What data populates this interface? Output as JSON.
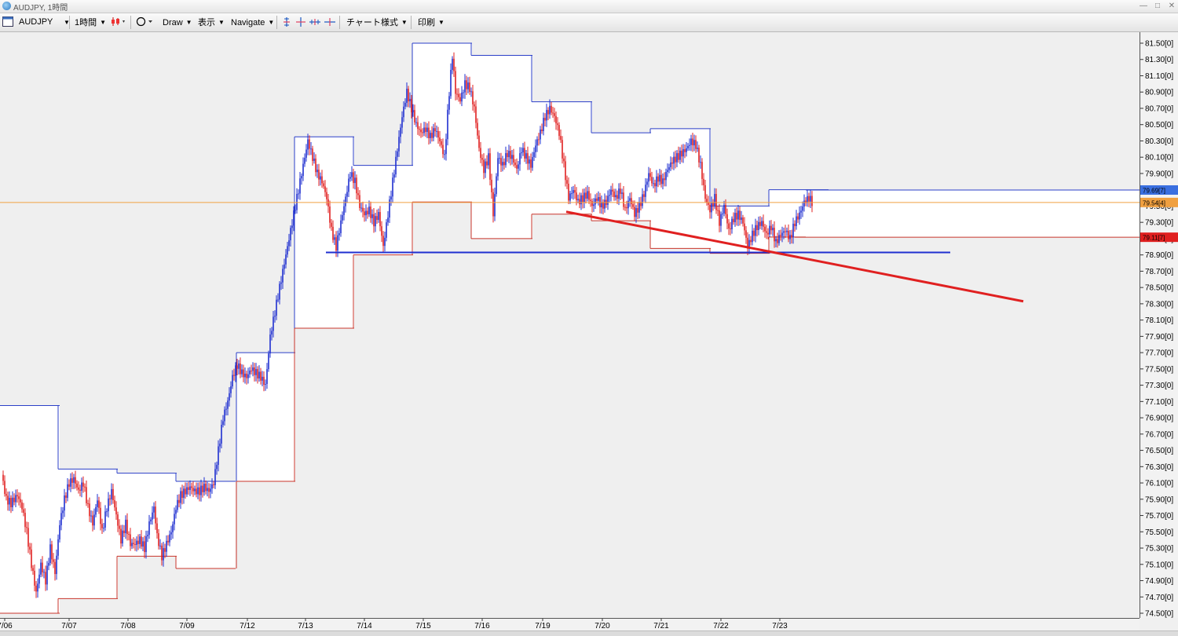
{
  "window": {
    "title": "AUDJPY, 1時間"
  },
  "toolbar": {
    "symbol": "AUDJPY",
    "timeframe": "1時間",
    "draw": "Draw",
    "display": "表示",
    "navigate": "Navigate",
    "chart_style": "チャート様式",
    "print": "印刷"
  },
  "chart_data": {
    "type": "candlestick",
    "symbol": "AUDJPY",
    "timeframe": "1時間",
    "ylim": [
      74.5,
      81.6
    ],
    "y_ticks": [
      "81.50[0]",
      "81.30[0]",
      "81.10[0]",
      "80.90[0]",
      "80.70[0]",
      "80.50[0]",
      "80.30[0]",
      "80.10[0]",
      "79.90[0]",
      "79.70[0]",
      "79.50[0]",
      "79.30[0]",
      "79.10[0]",
      "78.90[0]",
      "78.70[0]",
      "78.50[0]",
      "78.30[0]",
      "78.10[0]",
      "77.90[0]",
      "77.70[0]",
      "77.50[0]",
      "77.30[0]",
      "77.10[0]",
      "76.90[0]",
      "76.70[0]",
      "76.50[0]",
      "76.30[0]",
      "76.10[0]",
      "75.90[0]",
      "75.70[0]",
      "75.50[0]",
      "75.30[0]",
      "75.10[0]",
      "74.90[0]",
      "74.70[0]",
      "74.50[0]"
    ],
    "x_ticks": [
      "7/06",
      "7/07",
      "7/08",
      "7/09",
      "7/12",
      "7/13",
      "7/14",
      "7/15",
      "7/16",
      "7/19",
      "7/20",
      "7/21",
      "7/22",
      "7/23"
    ],
    "price_markers": [
      {
        "label": "79.69[7]",
        "value": 79.697,
        "color": "#3a6fe0"
      },
      {
        "label": "79.54[4]",
        "value": 79.544,
        "color": "#f0a040"
      },
      {
        "label": "79.11[7]",
        "value": 79.117,
        "color": "#e02020"
      }
    ],
    "current_price_line": 79.544,
    "support_line": {
      "value": 78.93,
      "color": "#1f2fd0"
    },
    "trend_line": {
      "from": [
        "7/19",
        79.43
      ],
      "to": [
        "7/23",
        78.92
      ],
      "color": "#e02020"
    },
    "daily_range_boxes": [
      {
        "label": "7/06",
        "high": 77.05,
        "low": 74.5
      },
      {
        "label": "7/07",
        "high": 76.27,
        "low": 74.68
      },
      {
        "label": "7/08",
        "high": 76.22,
        "low": 75.2
      },
      {
        "label": "7/09",
        "high": 76.12,
        "low": 75.05
      },
      {
        "label": "7/12",
        "high": 77.7,
        "low": 76.12
      },
      {
        "label": "7/13",
        "high": 80.35,
        "low": 78.0
      },
      {
        "label": "7/14",
        "high": 80.0,
        "low": 78.9
      },
      {
        "label": "7/15",
        "high": 81.5,
        "low": 79.55
      },
      {
        "label": "7/16",
        "high": 81.35,
        "low": 79.1
      },
      {
        "label": "7/19",
        "high": 80.78,
        "low": 79.4
      },
      {
        "label": "7/20",
        "high": 80.4,
        "low": 79.32
      },
      {
        "label": "7/21",
        "high": 80.45,
        "low": 78.98
      },
      {
        "label": "7/22",
        "high": 79.5,
        "low": 78.92
      },
      {
        "label": "7/23",
        "high": 79.7,
        "low": 79.12
      }
    ]
  }
}
